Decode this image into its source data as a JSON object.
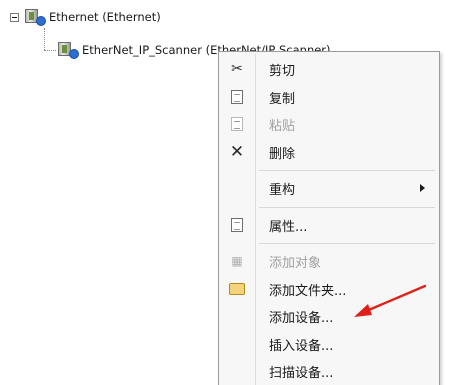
{
  "tree": {
    "root_label": "Ethernet (Ethernet)",
    "child_label": "EtherNet_IP_Scanner (EtherNet/IP Scanner)"
  },
  "context_menu": {
    "items": [
      {
        "label": "剪切",
        "icon": "cut-icon",
        "enabled": true
      },
      {
        "label": "复制",
        "icon": "copy-icon",
        "enabled": true
      },
      {
        "label": "粘贴",
        "icon": "paste-icon",
        "enabled": false
      },
      {
        "label": "删除",
        "icon": "delete-icon",
        "enabled": true
      },
      {
        "label": "重构",
        "icon": "",
        "enabled": true,
        "submenu": true
      },
      {
        "label": "属性...",
        "icon": "properties-icon",
        "enabled": true
      },
      {
        "label": "添加对象",
        "icon": "add-object-icon",
        "enabled": false
      },
      {
        "label": "添加文件夹...",
        "icon": "folder-icon",
        "enabled": true
      },
      {
        "label": "添加设备...",
        "icon": "",
        "enabled": true
      },
      {
        "label": "插入设备...",
        "icon": "",
        "enabled": true
      },
      {
        "label": "扫描设备...",
        "icon": "",
        "enabled": true
      }
    ]
  },
  "annotation": {
    "arrow_color": "#e0201b"
  }
}
